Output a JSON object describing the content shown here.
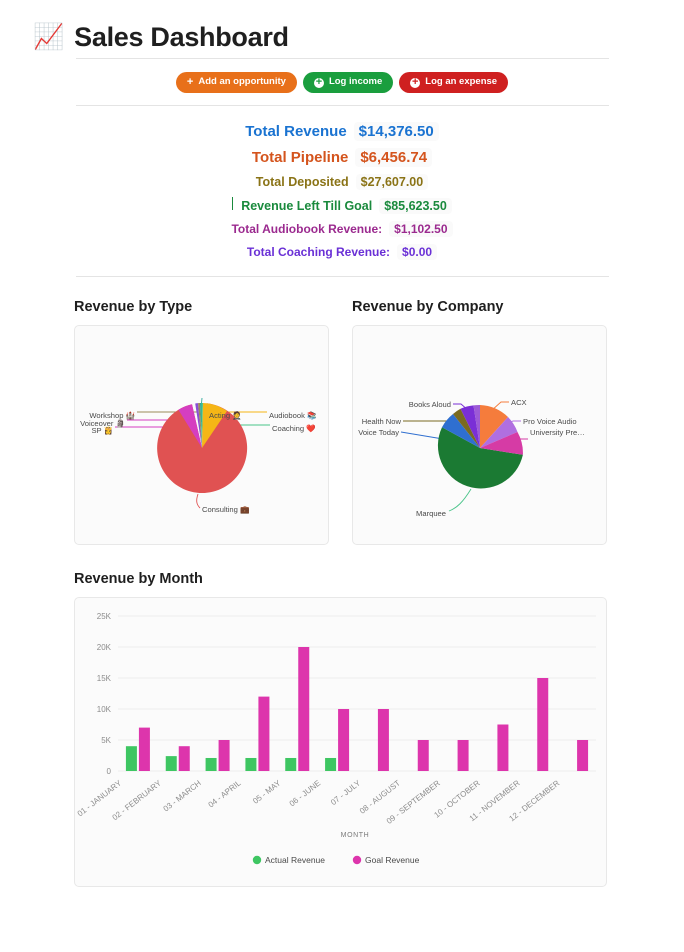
{
  "header": {
    "icon": "chart-increasing-icon",
    "icon_glyph": "📈",
    "title": "Sales Dashboard"
  },
  "toolbar": {
    "buttons": [
      {
        "label": "Add an opportunity",
        "glyph": "+",
        "color": "#e8701a",
        "name": "add-opportunity-button"
      },
      {
        "label": "Log income",
        "glyph": "+",
        "color": "#1a9e3e",
        "name": "log-income-button"
      },
      {
        "label": "Log an expense",
        "glyph": "+",
        "color": "#cf2020",
        "name": "log-expense-button"
      }
    ]
  },
  "metrics": [
    {
      "label": "Total Revenue",
      "value": "$14,376.50",
      "color": "#1a73d1"
    },
    {
      "label": "Total Pipeline",
      "value": "$6,456.74",
      "color": "#d4541d"
    },
    {
      "label": "Total Deposited",
      "value": "$27,607.00",
      "color": "#8a7316"
    },
    {
      "label": "Revenue Left Till Goal",
      "value": "$85,623.50",
      "color": "#1a8a3d"
    },
    {
      "label": "Total Audiobook Revenue:",
      "value": "$1,102.50",
      "color": "#9b2a8f"
    },
    {
      "label": "Total Coaching Revenue:",
      "value": "$0.00",
      "color": "#6a30d6"
    }
  ],
  "charts": {
    "revenue_by_type": {
      "title": "Revenue by Type",
      "chart_data": {
        "type": "pie",
        "title": "Revenue by Type",
        "labels": [
          "Consulting 💼",
          "Voiceover 🗿",
          "Audiobook 📚",
          "SP 👸",
          "Workshop 🏰",
          "Acting 🤵",
          "Coaching ❤️"
        ],
        "values": [
          74.5,
          9.5,
          11.0,
          2.0,
          1.5,
          1.0,
          0.5
        ],
        "colors": [
          "#e05252",
          "#d53ec0",
          "#f5b616",
          "#8a4fd6",
          "#9b8b5a",
          "#2aa89a",
          "#4ac48a"
        ],
        "legend": "labels-with-leader-lines"
      }
    },
    "revenue_by_company": {
      "title": "Revenue by Company",
      "chart_data": {
        "type": "pie",
        "title": "Revenue by Company",
        "labels": [
          "Marquee",
          "ACX",
          "Pro Voice Audio",
          "University Pre…",
          "Voice Today",
          "Health Now",
          "Books Aloud"
        ],
        "values": [
          54.0,
          12.0,
          6.0,
          9.0,
          9.0,
          3.5,
          6.5
        ],
        "colors": [
          "#1b7a33",
          "#f57c3c",
          "#b06fe0",
          "#d63ba5",
          "#2f6fd0",
          "#7a6a20",
          "#7a2fd6"
        ],
        "legend": "labels-with-leader-lines"
      }
    },
    "revenue_by_month": {
      "title": "Revenue by Month",
      "chart_data": {
        "type": "bar",
        "title": "Revenue by Month",
        "xlabel": "MONTH",
        "ylabel": "",
        "ylim": [
          0,
          25000
        ],
        "yticks": [
          "0",
          "5K",
          "10K",
          "15K",
          "20K",
          "25K"
        ],
        "ytick_values": [
          0,
          5000,
          10000,
          15000,
          20000,
          25000
        ],
        "grid": true,
        "legend_position": "bottom",
        "categories": [
          "01 - JANUARY",
          "02 - FEBRUARY",
          "03 - MARCH",
          "04 - APRIL",
          "05 - MAY",
          "06 - JUNE",
          "07 - JULY",
          "08 - AUGUST",
          "09 - SEPTEMBER",
          "10 - OCTOBER",
          "11 - NOVEMBER",
          "12 - DECEMBER"
        ],
        "series": [
          {
            "name": "Actual Revenue",
            "color": "#3ec662",
            "values": [
              4000,
              2400,
              2100,
              2100,
              2100,
              2100,
              0,
              0,
              0,
              0,
              0,
              0
            ]
          },
          {
            "name": "Goal Revenue",
            "color": "#dd35ac",
            "values": [
              7000,
              4000,
              5000,
              12000,
              20000,
              10000,
              10000,
              5000,
              5000,
              7500,
              15000,
              5000
            ]
          }
        ]
      }
    }
  }
}
